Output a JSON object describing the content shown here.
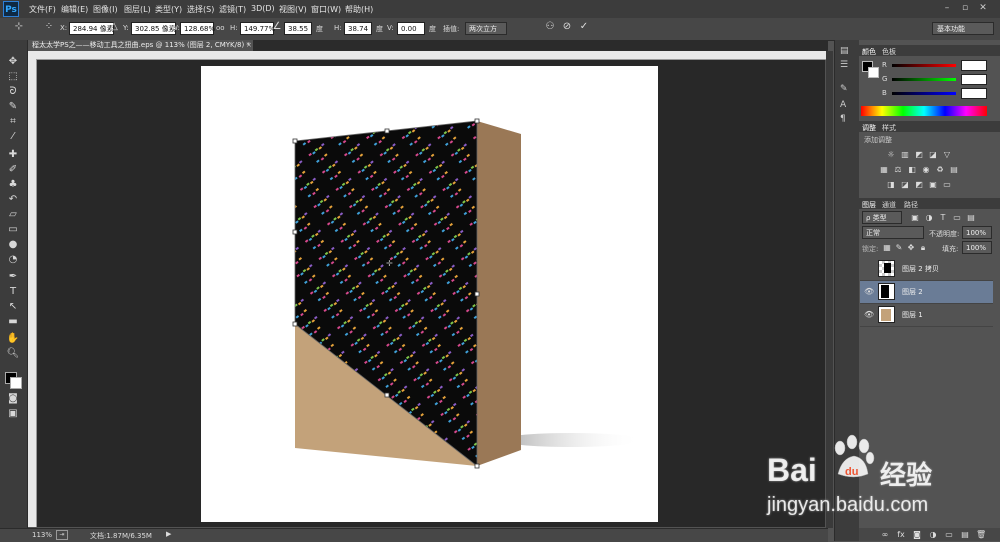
{
  "menubar": {
    "logo": "Ps",
    "items": [
      "文件(F)",
      "编辑(E)",
      "图像(I)",
      "图层(L)",
      "类型(Y)",
      "选择(S)",
      "滤镜(T)",
      "3D(D)",
      "视图(V)",
      "窗口(W)",
      "帮助(H)"
    ]
  },
  "options": {
    "x_label": "X:",
    "x_value": "284.94 像素",
    "y_label": "Y:",
    "y_value": "302.85 像素",
    "w_label": "W:",
    "w_value": "128.68%",
    "link_label": "oo",
    "h_label": "H:",
    "h_value": "149.77%",
    "angle_value": "38.55",
    "angle_unit": "度",
    "hskew_label": "H:",
    "hskew_value": "38.74",
    "hskew_unit": "度",
    "vskew_label": "V:",
    "vskew_value": "0.00",
    "vskew_unit": "度",
    "interp_label": "插值:",
    "interp_value": "两次立方",
    "workspace": "基本功能"
  },
  "document": {
    "tab_title": "程太太学PS之——移动工具之扭曲.eps @ 113% (图层 2, CMYK/8) *"
  },
  "status": {
    "zoom": "113%",
    "doc_size": "文档:1.87M/6.35M"
  },
  "panels": {
    "color_tabs": [
      "颜色",
      "色板"
    ],
    "color_channels": [
      "R",
      "G",
      "B"
    ],
    "adjust_tabs": [
      "调整",
      "样式"
    ],
    "adjust_title": "添加调整",
    "layers_tabs": [
      "图层",
      "通道",
      "路径"
    ],
    "kind_label": "ρ 类型",
    "blend_mode": "正常",
    "opacity_label": "不透明度:",
    "opacity_value": "100%",
    "lock_label": "锁定:",
    "fill_label": "填充:",
    "fill_value": "100%",
    "layers": [
      {
        "name": "图层 2 拷贝",
        "visible": false,
        "selected": false
      },
      {
        "name": "图层 2",
        "visible": true,
        "selected": true
      },
      {
        "name": "图层 1",
        "visible": true,
        "selected": false
      }
    ]
  },
  "watermark": {
    "brand": "Bai",
    "brand_tail": "经验",
    "url": "jingyan.baidu.com"
  },
  "colors": {
    "box_front": "#c3a27a",
    "box_side": "#9a7856",
    "pattern_bg": "#0a0a0a",
    "selected_layer": "#6a7c96"
  }
}
